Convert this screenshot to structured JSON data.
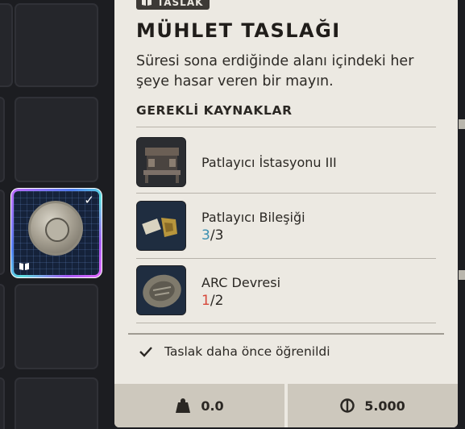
{
  "tag": {
    "label": "TASLAK",
    "icon": "book-icon"
  },
  "item": {
    "title": "MÜHLET TASLAĞI",
    "description": "Süresi sona erdiğinde alanı içindeki her şeye hasar veren bir mayın."
  },
  "requirements": {
    "header": "GEREKLİ KAYNAKLAR",
    "items": [
      {
        "name": "Patlayıcı İstasyonu III",
        "icon": "workbench-icon"
      },
      {
        "name": "Patlayıcı Bileşiği",
        "have": "3",
        "sep": "/",
        "need": "3",
        "icon": "explosive-compound-icon"
      },
      {
        "name": "ARC Devresi",
        "have": "1",
        "sep": "/",
        "need": "2",
        "icon": "arc-circuit-icon"
      }
    ]
  },
  "status": {
    "learned_text": "Taslak daha önce öğrenildi"
  },
  "footer": {
    "weight": "0.0",
    "price": "5.000"
  },
  "colors": {
    "panel": "#ece9e2",
    "footer": "#cdc8bd",
    "have_ok": "#3a8fb0",
    "have_bad": "#d6483a"
  }
}
